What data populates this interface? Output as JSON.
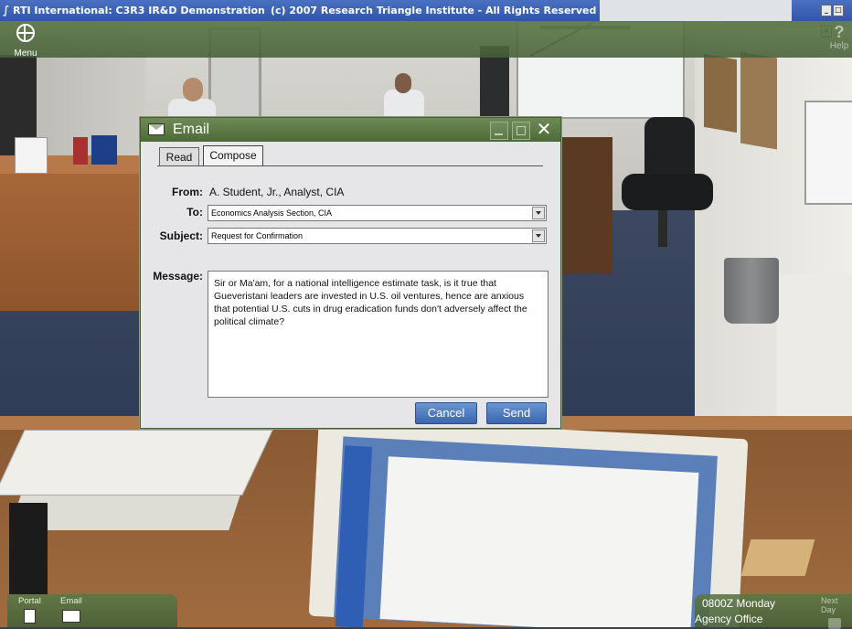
{
  "window": {
    "app_title": "RTI International: C3R3 IR&D Demonstration",
    "copyright": "(c) 2007 Research Triangle Institute - All Rights Reserved"
  },
  "topbar": {
    "menu_label": "Menu",
    "menu_icon": "globe-icon",
    "help_glyph": "?",
    "help_label": "Help"
  },
  "email_dialog": {
    "title": "Email",
    "close_glyph": "✕",
    "tabs": [
      {
        "label": "Read",
        "active": false
      },
      {
        "label": "Compose",
        "active": true
      }
    ],
    "from_label": "From:",
    "from_value": "A. Student, Jr., Analyst, CIA",
    "to_label": "To:",
    "to_value": "Economics Analysis Section, CIA",
    "subject_label": "Subject:",
    "subject_value": "Request for Confirmation",
    "message_label": "Message:",
    "message_text": "Sir or Ma'am, for a national intelligence estimate task, is it true that Gueveristani leaders are invested in U.S. oil ventures, hence are anxious that potential U.S. cuts in drug eradication funds don't adversely affect the political climate?",
    "cancel_label": "Cancel",
    "send_label": "Send"
  },
  "bottombar": {
    "portal_label": "Portal",
    "email_label": "Email",
    "time": "0800Z  Monday",
    "location": "Agency Office",
    "next_day_label": "Next Day"
  }
}
